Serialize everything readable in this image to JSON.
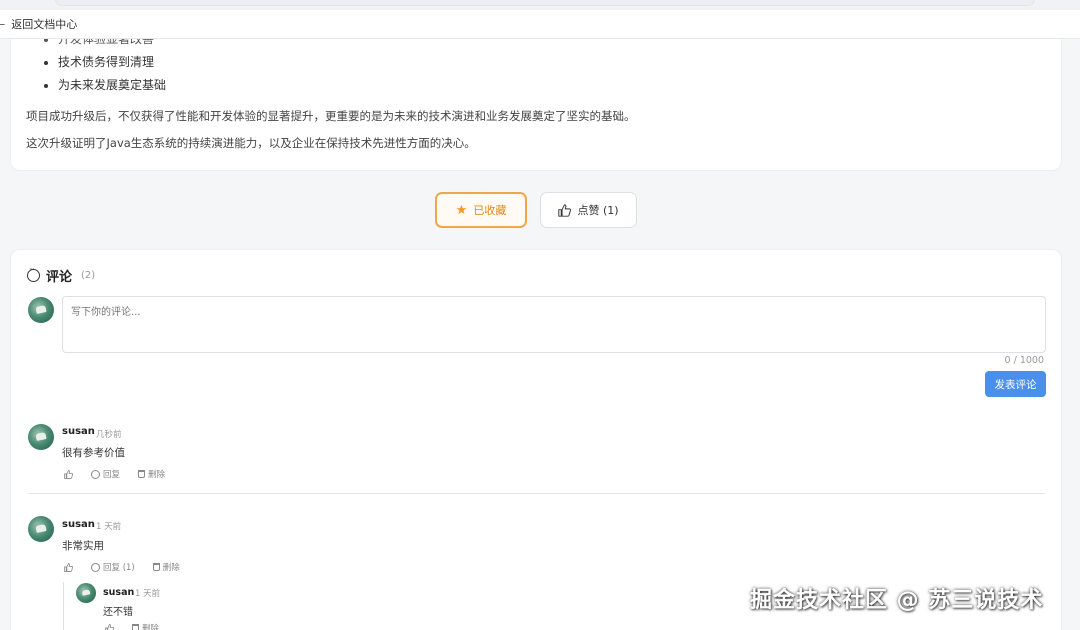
{
  "nav": {
    "back_label": "返回文档中心",
    "back_icon": "arrow-left-icon"
  },
  "article": {
    "bullets": [
      "开发体验显著改善",
      "技术债务得到清理",
      "为未来发展奠定基础"
    ],
    "paragraphs": [
      "项目成功升级后，不仅获得了性能和开发体验的显著提升，更重要的是为未来的技术演进和业务发展奠定了坚实的基础。",
      "这次升级证明了Java生态系统的持续演进能力，以及企业在保持技术先进性方面的决心。"
    ]
  },
  "actions": {
    "favorite_label": "已收藏",
    "favorite_icon": "star-icon",
    "like_label": "点赞 (1)",
    "like_icon": "thumbs-up-icon",
    "accent_color": "#f0a64a"
  },
  "comments": {
    "title": "评论",
    "count": "(2)",
    "placeholder": "写下你的评论...",
    "char_count": "0 / 1000",
    "submit_label": "发表评论",
    "submit_color": "#4a90ea",
    "items": [
      {
        "author": "susan",
        "time": "几秒前",
        "text": "很有参考价值",
        "reply_label": "回复",
        "delete_label": "删除"
      },
      {
        "author": "susan",
        "time": "1 天前",
        "text": "非常实用",
        "reply_label": "回复 (1)",
        "delete_label": "删除",
        "replies": [
          {
            "author": "susan",
            "time": "1 天前",
            "text": "还不错",
            "delete_label": "删除"
          }
        ]
      }
    ]
  },
  "watermark": "掘金技术社区 @ 苏三说技术"
}
